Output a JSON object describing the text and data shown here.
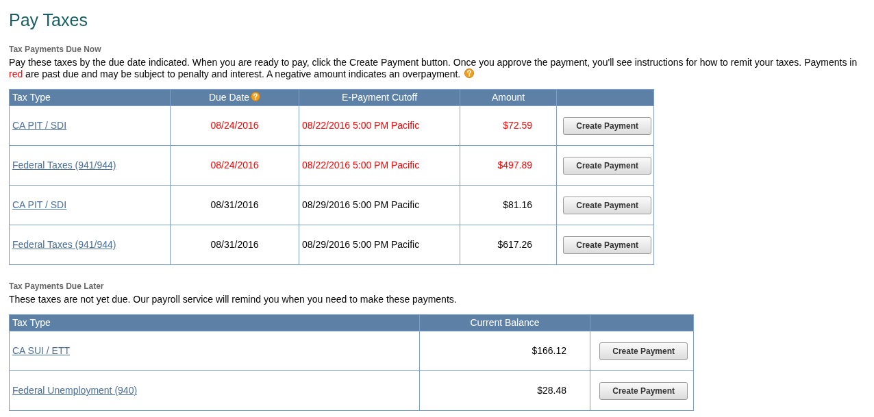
{
  "title": "Pay Taxes",
  "due_now": {
    "heading": "Tax Payments Due Now",
    "intro": {
      "before": "Pay these taxes by the due date indicated. When you are ready to pay, click the Create Payment button. Once you approve the payment, you'll see instructions for how to remit your taxes. Payments in ",
      "highlight": "red",
      "after": " are past due and may be subject to penalty and interest. A negative amount indicates an overpayment."
    },
    "columns": [
      "Tax Type",
      "Due Date",
      "E-Payment Cutoff",
      "Amount"
    ],
    "rows": [
      {
        "tax_type": "CA PIT / SDI",
        "due_date": "08/24/2016",
        "cutoff": "08/22/2016 5:00 PM Pacific",
        "amount": "$72.59",
        "past_due": true,
        "action": "Create Payment"
      },
      {
        "tax_type": "Federal Taxes (941/944)",
        "due_date": "08/24/2016",
        "cutoff": "08/22/2016 5:00 PM Pacific",
        "amount": "$497.89",
        "past_due": true,
        "action": "Create Payment"
      },
      {
        "tax_type": "CA PIT / SDI",
        "due_date": "08/31/2016",
        "cutoff": "08/29/2016 5:00 PM Pacific",
        "amount": "$81.16",
        "past_due": false,
        "action": "Create Payment"
      },
      {
        "tax_type": "Federal Taxes (941/944)",
        "due_date": "08/31/2016",
        "cutoff": "08/29/2016 5:00 PM Pacific",
        "amount": "$617.26",
        "past_due": false,
        "action": "Create Payment"
      }
    ]
  },
  "due_later": {
    "heading": "Tax Payments Due Later",
    "intro": "These taxes are not yet due. Our payroll service will remind you when you need to make these payments.",
    "columns": [
      "Tax Type",
      "Current Balance"
    ],
    "rows": [
      {
        "tax_type": "CA SUI / ETT",
        "balance": "$166.12",
        "action": "Create Payment"
      },
      {
        "tax_type": "Federal Unemployment (940)",
        "balance": "$28.48",
        "action": "Create Payment"
      }
    ]
  }
}
